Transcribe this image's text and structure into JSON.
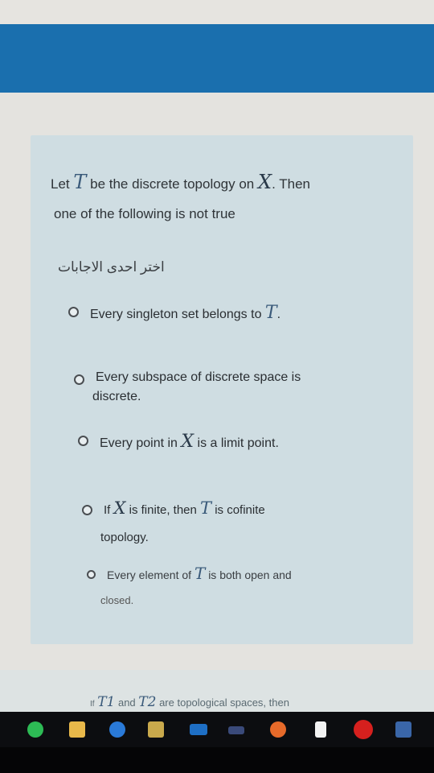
{
  "question": {
    "let": "Let",
    "symbol_T": "T",
    "middle": "be the discrete topology on",
    "symbol_X": "X",
    "then": ". Then",
    "line2": "one of the following is not true"
  },
  "instruction": "اختر احدى الاجابات",
  "options": [
    {
      "pre": "Every singleton set belongs to",
      "sym": "T",
      "post": "."
    },
    {
      "line1": "Every subspace of discrete space is",
      "line2": "discrete."
    },
    {
      "pre": "Every point in",
      "sym": "X",
      "post": "is a limit point."
    },
    {
      "pre": "If",
      "sym1": "X",
      "mid": "is finite, then",
      "sym2": "T",
      "post": "is cofinite",
      "line2": "topology."
    },
    {
      "pre": "Every element of",
      "sym": "T",
      "post": "is both open and",
      "line2": "closed."
    }
  ],
  "next_question": {
    "if": "If",
    "t1": "T1",
    "and": "and",
    "t2": "T2",
    "rest": "are topological spaces, then"
  },
  "colors": {
    "banner": "#1a6fae",
    "card": "#cfdde2",
    "taskbar": "#0c0d10"
  },
  "taskbar_icons": [
    "whatsapp-icon",
    "folder-icon",
    "edge-icon",
    "store-icon",
    "mail-icon",
    "people-icon",
    "music-icon",
    "document-icon",
    "opera-icon",
    "screen-icon"
  ]
}
